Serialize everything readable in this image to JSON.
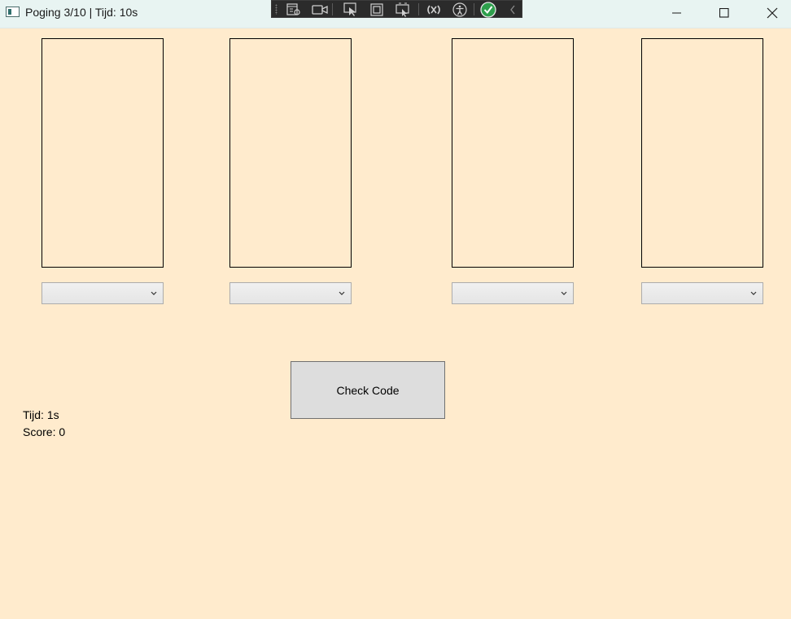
{
  "window": {
    "title": "Poging 3/10 | Tijd: 10s",
    "background": "#ffebcd"
  },
  "debug_toolbar": {
    "icons": [
      "live-visual-tree-icon",
      "record-icon",
      "select-element-icon",
      "display-layout-adorners-icon",
      "track-focus-icon",
      "hot-reload-icon",
      "accessibility-icon",
      "check-icon",
      "collapse-icon"
    ]
  },
  "code_slots": [
    {
      "combo_value": ""
    },
    {
      "combo_value": ""
    },
    {
      "combo_value": ""
    },
    {
      "combo_value": ""
    }
  ],
  "check_button": {
    "label": "Check Code"
  },
  "status": {
    "time_text": "Tijd: 1s",
    "score_text": "Score: 0"
  }
}
